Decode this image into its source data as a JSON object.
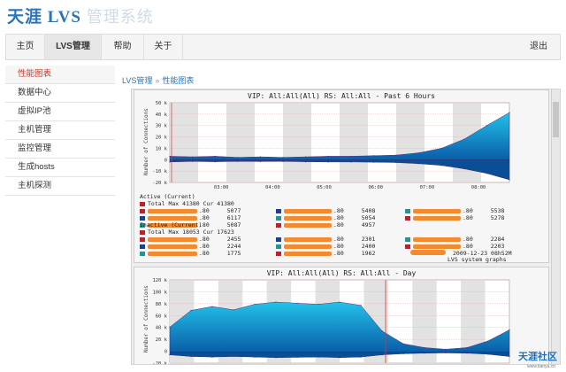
{
  "app": {
    "title_brand": "天涯 LVS",
    "title_suffix": "管理系统"
  },
  "nav": {
    "items": [
      {
        "label": "主页",
        "active": false
      },
      {
        "label": "LVS管理",
        "active": true
      },
      {
        "label": "帮助",
        "active": false
      },
      {
        "label": "关于",
        "active": false
      }
    ],
    "logout_label": "退出"
  },
  "sidebar": {
    "items": [
      {
        "label": "性能图表",
        "active": true
      },
      {
        "label": "数据中心",
        "active": false
      },
      {
        "label": "虚拟IP池",
        "active": false
      },
      {
        "label": "主机管理",
        "active": false
      },
      {
        "label": "监控管理",
        "active": false
      },
      {
        "label": "生成hosts",
        "active": false
      },
      {
        "label": "主机探测",
        "active": false
      }
    ]
  },
  "breadcrumb": {
    "parent": "LVS管理",
    "separator": "»",
    "current": "性能图表"
  },
  "graph1": {
    "title": "VIP: All:All(All) RS: All:All - Past 6 Hours",
    "ylabel": "Number of Connections",
    "yticks": [
      "50 k",
      "40 k",
      "30 k",
      "20 k",
      "10 k",
      "0",
      "-10 k",
      "-20 k"
    ],
    "xticks": [
      "03:00",
      "04:00",
      "05:00",
      "06:00",
      "07:00",
      "08:00"
    ],
    "active_header": "Active (Current)",
    "active_total": "Total   Max 41380   Cur 41380",
    "active_values": [
      [
        "80",
        "5077",
        "80",
        "5408",
        "80",
        "5538"
      ],
      [
        "80",
        "6117",
        "80",
        "5054",
        "80",
        "5278"
      ],
      [
        "80",
        "5087",
        "80",
        "4957"
      ]
    ],
    "inactive_header": "Inactive (Current)",
    "inactive_total": "Total   Max 18053   Cur 17623",
    "inactive_values": [
      [
        "80",
        "2455",
        "80",
        "2301",
        "80",
        "2284"
      ],
      [
        "80",
        "2244",
        "80",
        "2400",
        "80",
        "2203"
      ],
      [
        "80",
        "1775",
        "80",
        "1962"
      ]
    ],
    "footer_time": "2009-12-23 08h52M",
    "footer_src": "LVS system graphs"
  },
  "graph2": {
    "title": "VIP: All:All(All) RS: All:All - Day",
    "ylabel": "Number of Connections",
    "yticks": [
      "120 k",
      "100 k",
      "80 k",
      "60 k",
      "40 k",
      "20 k",
      "0",
      "-20 k"
    ]
  },
  "watermark": {
    "text": "天涯社区",
    "url": "www.tianya.cn"
  },
  "colors": {
    "brand": "#2b74b8",
    "active_red": "#c0392b",
    "redaction": "#f28a30",
    "graph_blue": "#0a5ea8"
  },
  "chart_data": [
    {
      "type": "area",
      "title": "VIP: All:All(All) RS: All:All - Past 6 Hours",
      "ylabel": "Number of Connections",
      "x": [
        "02:30",
        "03:00",
        "03:30",
        "04:00",
        "04:30",
        "05:00",
        "05:30",
        "06:00",
        "06:30",
        "07:00",
        "07:30",
        "08:00",
        "08:15",
        "08:30",
        "08:45",
        "08:52"
      ],
      "series": [
        {
          "name": "Active",
          "values": [
            3000,
            2500,
            3000,
            2000,
            2500,
            2000,
            2500,
            3000,
            3000,
            3500,
            4000,
            6000,
            10000,
            18000,
            30000,
            41380
          ]
        },
        {
          "name": "Inactive",
          "values": [
            -2000,
            -1500,
            -1800,
            -1500,
            -1600,
            -1500,
            -1800,
            -2000,
            -2000,
            -2200,
            -2500,
            -3500,
            -5000,
            -8000,
            -12000,
            -17623
          ]
        }
      ],
      "ylim": [
        -20000,
        50000
      ]
    },
    {
      "type": "area",
      "title": "VIP: All:All(All) RS: All:All - Day",
      "ylabel": "Number of Connections",
      "x": [
        0,
        2,
        4,
        6,
        8,
        10,
        12,
        14,
        16,
        18,
        20,
        22,
        24,
        26,
        28,
        30,
        32
      ],
      "series": [
        {
          "name": "Active",
          "values": [
            45000,
            75000,
            82000,
            76000,
            86000,
            90000,
            88000,
            86000,
            90000,
            84000,
            38000,
            15000,
            8000,
            5000,
            8000,
            20000,
            40000
          ]
        },
        {
          "name": "Inactive",
          "values": [
            -5000,
            -8000,
            -9000,
            -8000,
            -9000,
            -10000,
            -9500,
            -9000,
            -10000,
            -9000,
            -5000,
            -3000,
            -2000,
            -1500,
            -2000,
            -4000,
            -8000
          ]
        }
      ],
      "ylim": [
        -20000,
        130000
      ]
    }
  ]
}
